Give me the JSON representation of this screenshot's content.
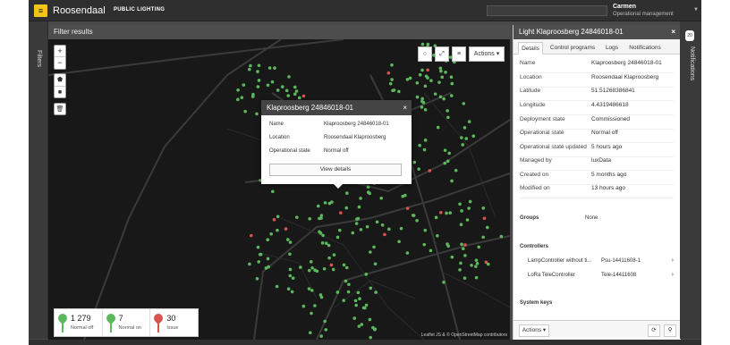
{
  "app": {
    "title": "Roosendaal",
    "subtitle": "PUBLIC LIGHTING",
    "menu_icon": "hamburger-icon"
  },
  "user": {
    "name": "Carmen",
    "role": "Operational management"
  },
  "filters": {
    "label": "Filters"
  },
  "map": {
    "header": "Filter results",
    "zoom_in": "+",
    "zoom_out": "−",
    "actions_label": "Actions",
    "attribution": "Leaflet JS & © OpenStreetMap contributors",
    "popup": {
      "title": "Klaproosberg 24846018-01",
      "rows": [
        {
          "label": "Name",
          "value": "Klaproosberg 24846018-01"
        },
        {
          "label": "Location",
          "value": "Roosendaal Klaproosberg"
        },
        {
          "label": "Operational state",
          "value": "Normal off"
        }
      ],
      "button": "View details"
    },
    "counts": [
      {
        "value": "1 279",
        "label": "Normal off",
        "color": "#5cb85c"
      },
      {
        "value": "7",
        "label": "Normal on",
        "color": "#5cb85c"
      },
      {
        "value": "30",
        "label": "Issue",
        "color": "#d9534f"
      }
    ]
  },
  "detail": {
    "title": "Light Klaproosberg 24846018-01",
    "tabs": [
      "Details",
      "Control programs",
      "Logs",
      "Notifications"
    ],
    "rows": [
      {
        "label": "Name",
        "value": "Klaproosberg 24846018-01"
      },
      {
        "label": "Location",
        "value": "Roosendaal Klaproosberg"
      },
      {
        "label": "Latitude",
        "value": "51.51268386841"
      },
      {
        "label": "Longitude",
        "value": "4.4319486618"
      },
      {
        "label": "Deployment state",
        "value": "Commissioned"
      },
      {
        "label": "Operational state",
        "value": "Normal off"
      },
      {
        "label": "Operational state updated",
        "value": "5 hours ago"
      },
      {
        "label": "Managed by",
        "value": "luxData"
      },
      {
        "label": "Created on",
        "value": "5 months ago"
      },
      {
        "label": "Modified on",
        "value": "13 hours ago"
      }
    ],
    "groups": {
      "label": "Groups",
      "value": "None"
    },
    "controllers": {
      "label": "Controllers",
      "items": [
        {
          "name": "LampController without ti...",
          "value": "Psu-14411608-1"
        },
        {
          "name": "LoRa TeleController",
          "value": "Tele-14411608"
        }
      ]
    },
    "system_keys": {
      "label": "System keys"
    },
    "footer": {
      "actions_label": "Actions"
    }
  },
  "notifications": {
    "label": "Notifications",
    "count": "20"
  },
  "colors": {
    "accent": "#f0c419",
    "light_ok": "#5cb85c",
    "light_issue": "#d9534f"
  }
}
